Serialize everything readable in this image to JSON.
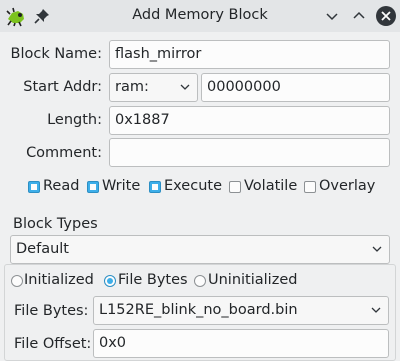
{
  "window": {
    "title": "Add Memory Block",
    "icons": [
      "app-icon",
      "pin-icon",
      "minimize-icon",
      "maximize-icon",
      "close-icon"
    ]
  },
  "form": {
    "block_name_label": "Block Name:",
    "block_name_value": "flash_mirror",
    "start_addr_label": "Start Addr:",
    "start_addr_space": "ram:",
    "start_addr_value": "00000000",
    "length_label": "Length:",
    "length_value": "0x1887",
    "comment_label": "Comment:",
    "comment_value": ""
  },
  "permissions": [
    {
      "label": "Read",
      "checked": true
    },
    {
      "label": "Write",
      "checked": true
    },
    {
      "label": "Execute",
      "checked": true
    },
    {
      "label": "Volatile",
      "checked": false
    },
    {
      "label": "Overlay",
      "checked": false
    }
  ],
  "block_types": {
    "label": "Block Types",
    "selected": "Default"
  },
  "init": {
    "options": [
      {
        "label": "Initialized",
        "selected": false
      },
      {
        "label": "File Bytes",
        "selected": true
      },
      {
        "label": "Uninitialized",
        "selected": false
      }
    ],
    "file_bytes_label": "File Bytes:",
    "file_bytes_value": "L152RE_blink_no_board.bin",
    "file_offset_label": "File Offset:",
    "file_offset_value": "0x0"
  },
  "colors": {
    "accent": "#3daee9",
    "background": "#eff0f1",
    "close_button": "#31363b"
  }
}
